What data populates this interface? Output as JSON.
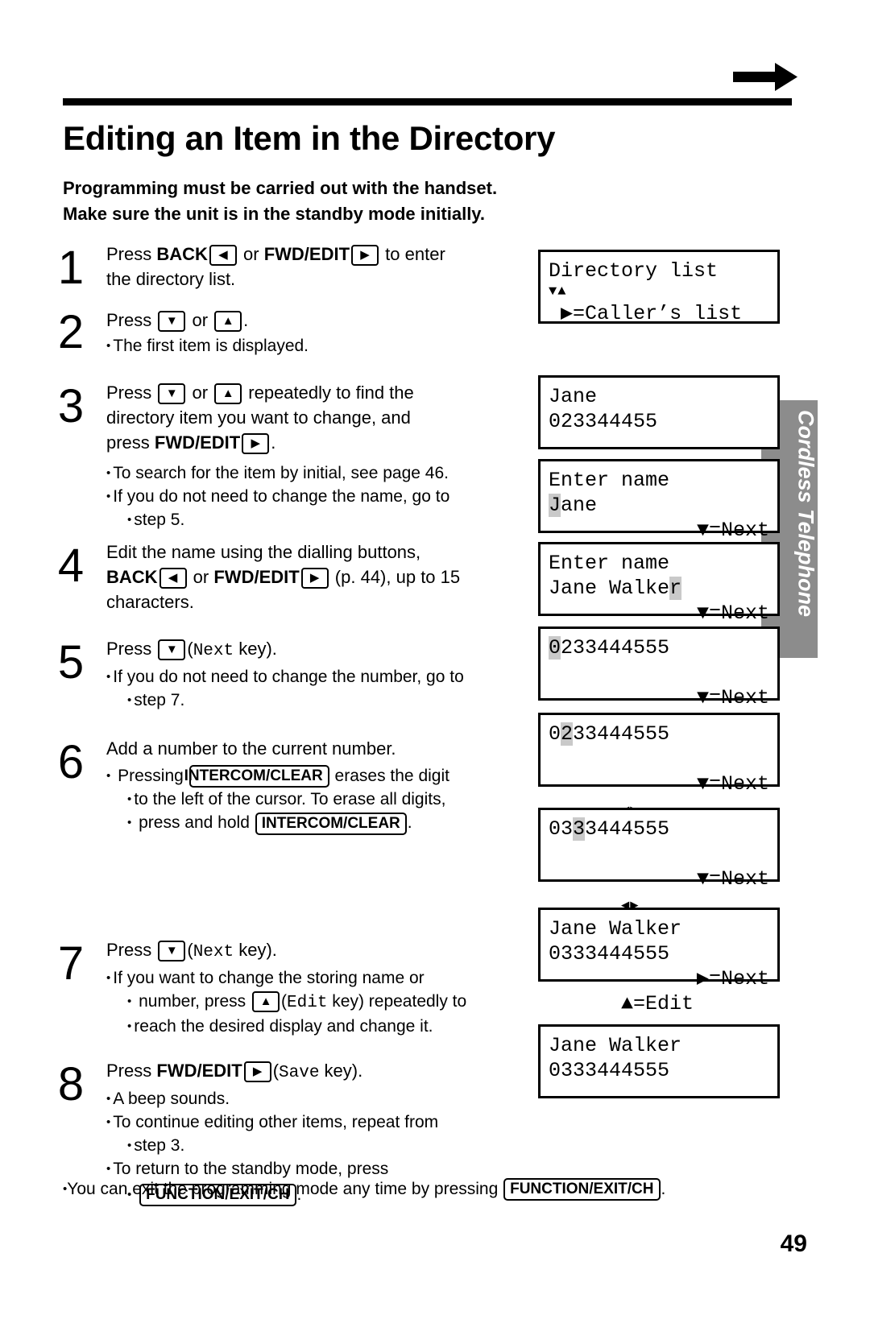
{
  "page": {
    "number": "49",
    "side_tab": "Cordless Telephone",
    "title": "Editing an Item in the Directory",
    "subtitle_line1": "Programming must be carried out with the handset.",
    "subtitle_line2": "Make sure the unit is in the standby mode initially.",
    "footer_note_pre": "You can exit the programming mode any time by pressing ",
    "footer_note_key": "FUNCTION/EXIT/CH",
    "footer_note_post": "."
  },
  "steps": [
    {
      "num": "1",
      "line1_pre": "Press ",
      "line1_b1": "BACK",
      "line1_mid": " or ",
      "line1_b2": "FWD/EDIT",
      "line1_post": " to enter",
      "line2": "the directory list.",
      "bullets": []
    },
    {
      "num": "2",
      "line1_pre": "Press ",
      "line1_mid": " or ",
      "line1_post": ".",
      "bullets": [
        "The first item is displayed."
      ]
    },
    {
      "num": "3",
      "line1_pre": "Press ",
      "line1_mid": " or ",
      "line1_post": " repeatedly to find the",
      "line2": "directory item you want to change, and",
      "line3_pre": "press ",
      "line3_b": "FWD/EDIT",
      "line3_post": ".",
      "bullets": [
        "To search for the item by initial, see page 46.",
        "If you do not need to change the name, go to",
        "step 5."
      ]
    },
    {
      "num": "4",
      "line1": "Edit the name using the dialling buttons,",
      "line2_b1": "BACK",
      "line2_mid": " or ",
      "line2_b2": "FWD/EDIT",
      "line2_post": " (p. 44), up to 15",
      "line3": "characters.",
      "bullets": []
    },
    {
      "num": "5",
      "line1_pre": "Press ",
      "line1_mono": "Next",
      "line1_post": " key).",
      "line1_paren": "(",
      "bullets": [
        "If you do not need to change the number, go to",
        "step 7."
      ]
    },
    {
      "num": "6",
      "line1": "Add a number to the current number.",
      "bullet_pre": "Pressing ",
      "bullet_key": "INTERCOM/CLEAR",
      "bullet_post": " erases the digit",
      "bullet_l2": "to the left of the cursor. To erase all digits,",
      "bullet_l3_pre": "press and hold ",
      "bullet_l3_key": "INTERCOM/CLEAR",
      "bullet_l3_post": "."
    },
    {
      "num": "7",
      "line1_pre": "Press ",
      "line1_mono": "Next",
      "line1_post": " key).",
      "bullets_l1": "If you want to change the storing name or",
      "bullets_l2_pre": "number, press ",
      "bullets_l2_mono": "Edit",
      "bullets_l2_post": " key) repeatedly to",
      "bullets_l3": "reach the desired display and change it."
    },
    {
      "num": "8",
      "line1_pre": "Press ",
      "line1_b": "FWD/EDIT",
      "line1_mono": "Save",
      "line1_post": " key).",
      "bullets": [
        "A beep sounds.",
        "To continue editing other items, repeat from",
        "step 3.",
        "To return to the standby mode, press"
      ],
      "bullet_key": "FUNCTION/EXIT/CH",
      "bullet_key_post": "."
    }
  ],
  "displays": [
    {
      "id": "display-1",
      "row1": "Directory list",
      "row2": "▼▲",
      "row3": " ▶=Caller’s list"
    },
    {
      "id": "display-2",
      "row1": "Jane",
      "row2": "023344455"
    },
    {
      "id": "display-3",
      "row1": "Enter name",
      "row2_hl": "J",
      "row2_rest": "ane",
      "row3_left": "◀▶",
      "row3_right": "▼=Next"
    },
    {
      "id": "display-4",
      "row1": "Enter name",
      "row2_plain": "Jane Walke",
      "row2_hl": "r",
      "row3_left": "◀▶",
      "row3_right": "▼=Next"
    },
    {
      "id": "display-5",
      "row1_hl": "0",
      "row1_rest": "233444555",
      "row3_left": "◀▶",
      "row3_right": "▼=Next"
    },
    {
      "id": "display-6",
      "row1_pre": "0",
      "row1_hl": "2",
      "row1_rest": "33444555",
      "row3_left": "◀▶",
      "row3_right": "▼=Next"
    },
    {
      "id": "display-7",
      "row1_pre": "03",
      "row1_hl": "3",
      "row1_rest": "3444555",
      "row3_left": "◀▶",
      "row3_right": "▼=Next"
    },
    {
      "id": "display-8",
      "row1": "Jane Walker",
      "row2": "0333444555",
      "row3_left": "▲=Edit",
      "row3_right": "▶=Next"
    },
    {
      "id": "display-9",
      "row1": "Jane Walker",
      "row2": "0333444555"
    }
  ],
  "glyphs": {
    "left": "◀",
    "right": "▶",
    "down": "▼",
    "up": "▲"
  }
}
